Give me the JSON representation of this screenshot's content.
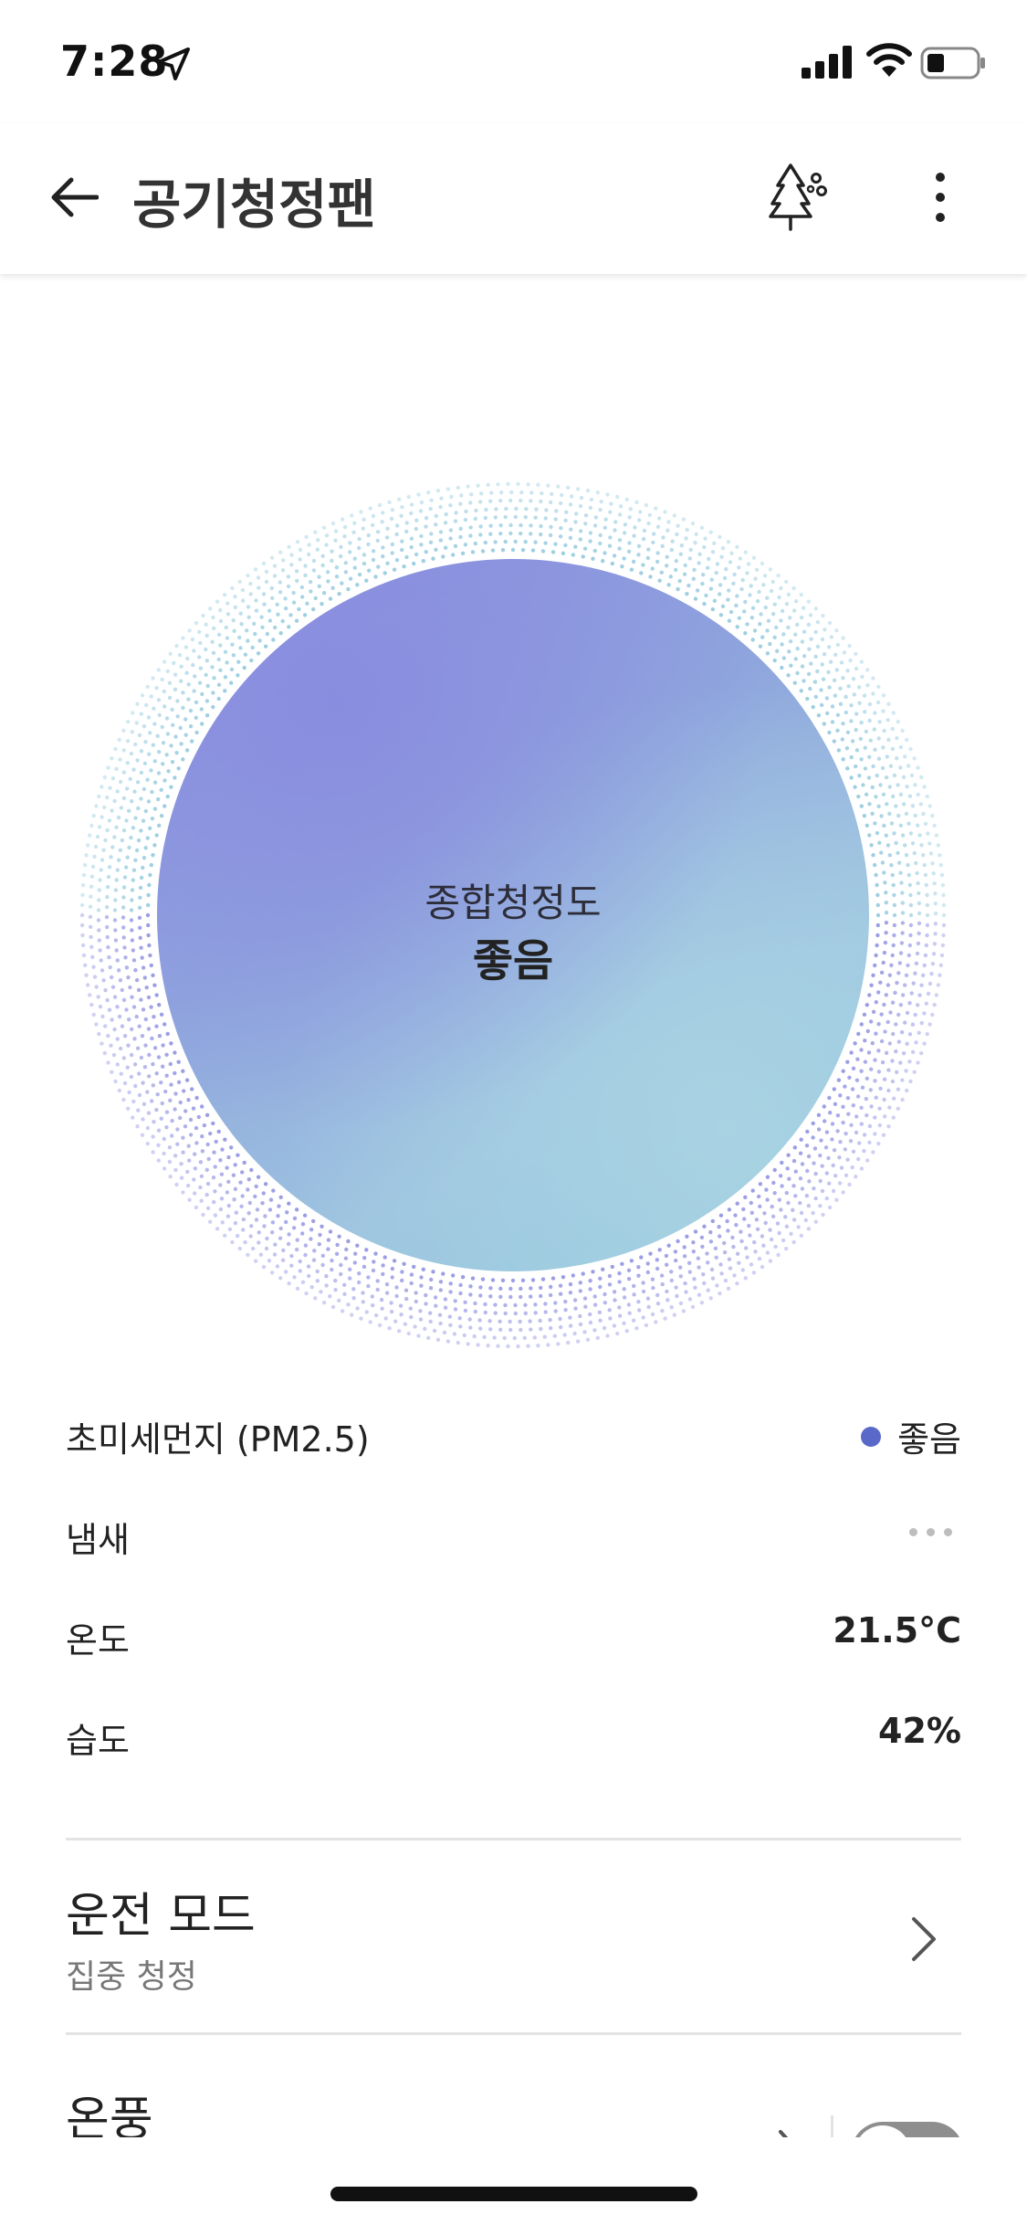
{
  "status_bar": {
    "time": "7:28",
    "icons": [
      "location-arrow-icon",
      "cellular-signal-icon",
      "wifi-icon",
      "battery-icon"
    ]
  },
  "app_bar": {
    "title": "공기청정팬",
    "icons": [
      "back-arrow-icon",
      "tree-icon",
      "more-vertical-icon"
    ]
  },
  "air_quality": {
    "label": "종합청정도",
    "value": "좋음",
    "colors": {
      "purple": "#8a8ddf",
      "blue": "#8ec7db"
    }
  },
  "metrics": [
    {
      "label": "초미세먼지 (PM2.5)",
      "value": "좋음",
      "dot_color": "#5a69c9"
    },
    {
      "label": "냄새",
      "value": ""
    },
    {
      "label": "온도",
      "value": "21.5°C"
    },
    {
      "label": "습도",
      "value": "42%"
    }
  ],
  "operation_mode": {
    "title": "운전 모드",
    "value": "집중 청정"
  },
  "heating": {
    "title": "온풍",
    "toggle_on": false
  }
}
